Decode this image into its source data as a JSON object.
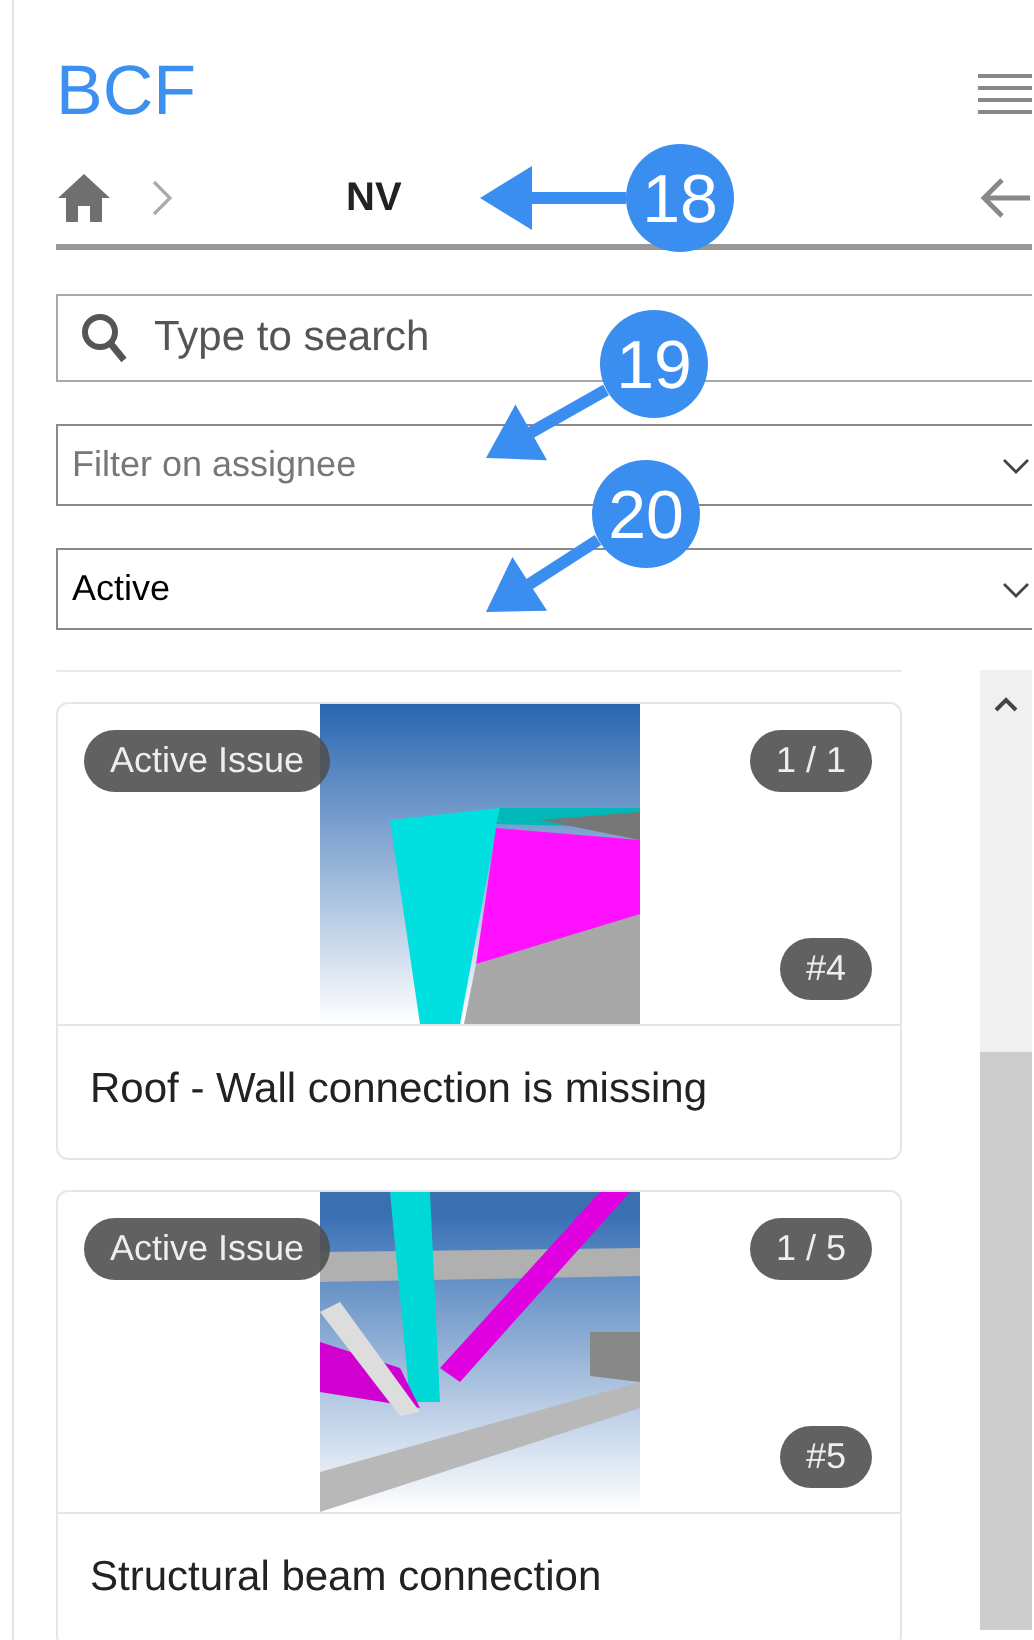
{
  "header": {
    "title": "BCF"
  },
  "breadcrumb": {
    "current": "NV"
  },
  "search": {
    "placeholder": "Type to search"
  },
  "filters": [
    {
      "placeholder": "Filter on assignee"
    },
    {
      "value": "Active"
    }
  ],
  "issues": [
    {
      "kind": "roof",
      "status": "Active Issue",
      "viewpoint": "1 / 1",
      "number": "#4",
      "title": "Roof - Wall connection is missing"
    },
    {
      "kind": "beams",
      "status": "Active Issue",
      "viewpoint": "1 / 5",
      "number": "#5",
      "title": "Structural beam connection"
    }
  ],
  "callouts": [
    {
      "label": "18"
    },
    {
      "label": "19"
    },
    {
      "label": "20"
    }
  ]
}
